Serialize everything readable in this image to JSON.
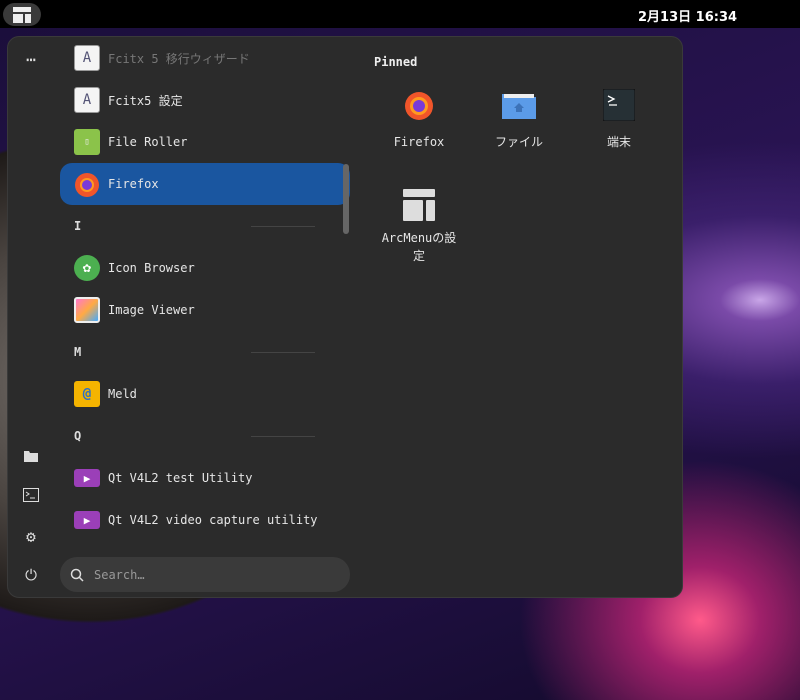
{
  "topbar": {
    "clock": "2月13日 16:34"
  },
  "menu": {
    "list": [
      {
        "type": "app",
        "label": "Fcitx 5 移行ウィザード",
        "icon": "fcitx-icon",
        "dim": true
      },
      {
        "type": "app",
        "label": "Fcitx5 設定",
        "icon": "fcitx-icon"
      },
      {
        "type": "app",
        "label": "File Roller",
        "icon": "archive-icon"
      },
      {
        "type": "app",
        "label": "Firefox",
        "icon": "firefox-icon",
        "selected": true
      },
      {
        "type": "header",
        "label": "I"
      },
      {
        "type": "app",
        "label": "Icon Browser",
        "icon": "gnome-icon"
      },
      {
        "type": "app",
        "label": "Image Viewer",
        "icon": "image-viewer-icon"
      },
      {
        "type": "header",
        "label": "M"
      },
      {
        "type": "app",
        "label": "Meld",
        "icon": "meld-icon"
      },
      {
        "type": "header",
        "label": "Q"
      },
      {
        "type": "app",
        "label": "Qt V4L2 test Utility",
        "icon": "play-icon"
      },
      {
        "type": "app",
        "label": "Qt V4L2 video capture utility",
        "icon": "play-icon"
      }
    ],
    "search_placeholder": "Search…",
    "pinned_title": "Pinned",
    "pinned": [
      {
        "label": "Firefox"
      },
      {
        "label": "ファイル"
      },
      {
        "label": "端末"
      },
      {
        "label": "ArcMenuの設定"
      }
    ]
  }
}
